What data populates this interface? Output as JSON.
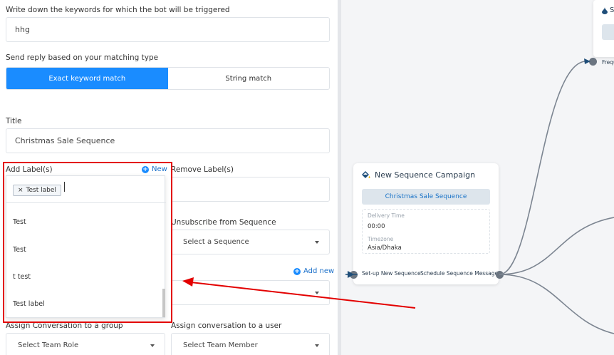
{
  "form": {
    "keywords_label": "Write down the keywords for which the bot will be triggered",
    "keywords_value": "hhg",
    "match_label": "Send reply based on your matching type",
    "match_options": [
      "Exact keyword match",
      "String match"
    ],
    "title_label": "Title",
    "title_value": "Christmas Sale Sequence",
    "add_label_label": "Add Label(s)",
    "new_link": "New",
    "remove_label_label": "Remove Label(s)",
    "unsubscribe_label": "Unsubscribe from Sequence",
    "unsubscribe_placeholder": "Select a Sequence",
    "add_new_link": "Add new",
    "assign_group_label": "Assign Conversation to a group",
    "assign_group_placeholder": "Select Team Role",
    "assign_user_label": "Assign conversation to a user",
    "assign_user_placeholder": "Select Team Member"
  },
  "label_dropdown": {
    "selected_tag": "Test label",
    "tag_remove": "×",
    "options": [
      "Test",
      "Test",
      "t test",
      "Test label"
    ]
  },
  "flow": {
    "node": {
      "title": "New Sequence Campaign",
      "sequence_button": "Christmas Sale Sequence",
      "delivery_time_label": "Delivery Time",
      "delivery_time_value": "00:00",
      "timezone_label": "Timezone",
      "timezone_value": "Asia/Dhaka",
      "input_label": "Set-up New Sequence",
      "output_label": "Schedule Sequence Message"
    },
    "top_node": {
      "title": "S",
      "footer": "Frequ"
    }
  },
  "colors": {
    "accent": "#1a8cff",
    "annotation": "#e30000"
  }
}
